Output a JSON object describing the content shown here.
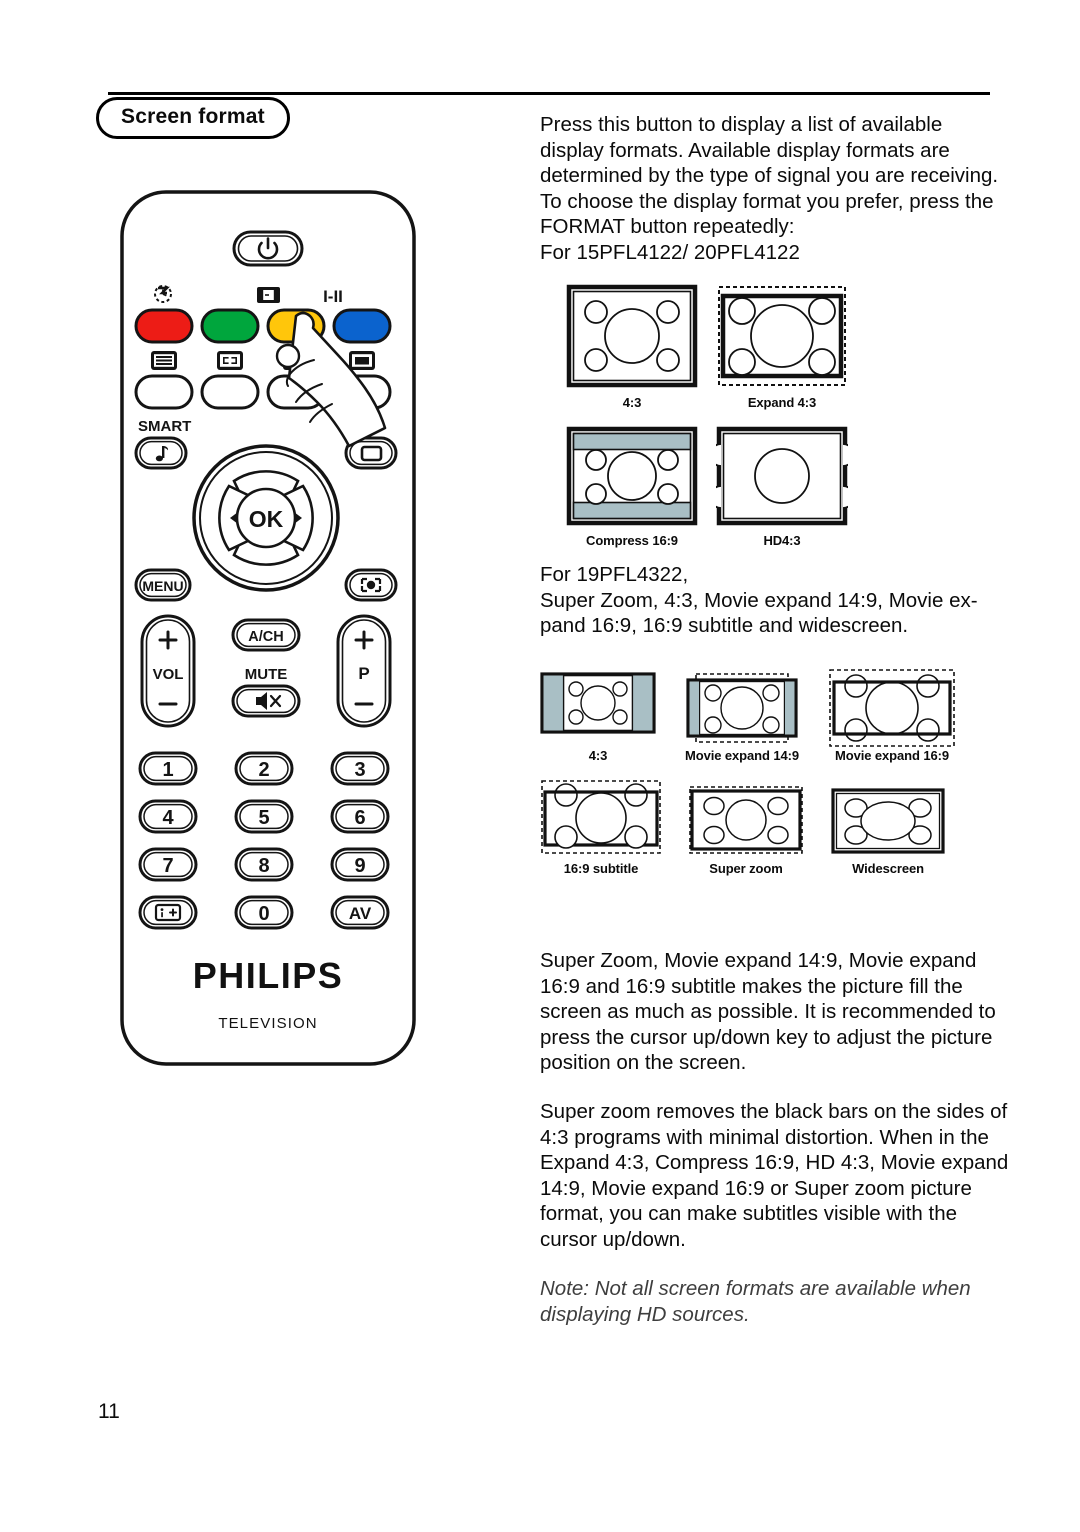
{
  "section": {
    "title": "Screen format"
  },
  "page": {
    "number": "11"
  },
  "body": {
    "p1": "Press this button to display a list of available display formats. Available display formats are determined by the type of signal you are receiving. To choose the display format you prefer, press the FORMAT button repeatedly:",
    "p1_model_line": "For 15PFL4122/ 20PFL4122",
    "p2_model_line": "For 19PFL4322,",
    "p2": "Super Zoom, 4:3, Movie expand 14:9, Movie ex-pand 16:9, 16:9 subtitle and widescreen.",
    "p3": "Super Zoom, Movie expand 14:9, Movie expand 16:9 and 16:9 subtitle makes the picture fill the screen as much as possible. It is recommended to press the cursor up/down key to adjust the picture position on the screen.",
    "p4": "Super zoom removes the black bars on the sides of 4:3 programs with minimal distortion. When in the Expand 4:3, Compress 16:9, HD 4:3, Movie expand 14:9, Movie expand 16:9 or Super zoom picture format, you can make subtitles visible with the cursor up/down.",
    "note": "Note: Not all screen formats are available when displaying HD sources."
  },
  "format_group_1": {
    "row1": [
      {
        "caption": "4:3",
        "icon": "format-4-3-diagram"
      },
      {
        "caption": "Expand 4:3",
        "icon": "format-expand-4-3-diagram"
      }
    ],
    "row2": [
      {
        "caption": "Compress 16:9",
        "icon": "format-compress-16-9-diagram"
      },
      {
        "caption": "HD4:3",
        "icon": "format-hd-4-3-diagram"
      }
    ]
  },
  "format_group_2": {
    "row1": [
      {
        "caption": "4:3",
        "icon": "format-4-3-wide-diagram"
      },
      {
        "caption": "Movie expand 14:9",
        "icon": "format-movie-expand-14-9-diagram"
      },
      {
        "caption": "Movie expand 16:9",
        "icon": "format-movie-expand-16-9-diagram"
      }
    ],
    "row2": [
      {
        "caption": "16:9 subtitle",
        "icon": "format-16-9-subtitle-diagram"
      },
      {
        "caption": "Super zoom",
        "icon": "format-super-zoom-diagram"
      },
      {
        "caption": "Widescreen",
        "icon": "format-widescreen-diagram"
      }
    ]
  },
  "remote": {
    "brand": "PHILIPS",
    "sub_brand": "TELEVISION",
    "power_button": "power-icon",
    "color_buttons": [
      {
        "name": "red",
        "color": "#ED1C16",
        "top_icon": "sleep-timer-icon",
        "below_icon": "teletext-icon"
      },
      {
        "name": "green",
        "color": "#00A63D",
        "top_icon": "",
        "below_icon": "subpage-icon"
      },
      {
        "name": "yellow",
        "color": "#FFC60B",
        "top_icon": "format-icon",
        "below_icon": "list-icon"
      },
      {
        "name": "blue",
        "color": "#0B63CE",
        "top_icon": "I-II",
        "below_icon": "screen-icon"
      }
    ],
    "smart_label": "SMART",
    "smart_icon": "music-note-icon",
    "smart_picture_icon": "screen-icon",
    "ok_label": "OK",
    "menu_label": "MENU",
    "surf_icon": "pixel-plus-icon",
    "vol_label": "VOL",
    "vol_plus": "+",
    "vol_minus": "−",
    "ach_label": "A/CH",
    "mute_label": "MUTE",
    "mute_icon": "mute-icon",
    "p_label": "P",
    "p_plus": "+",
    "p_minus": "−",
    "keypad": [
      "1",
      "2",
      "3",
      "4",
      "5",
      "6",
      "7",
      "8",
      "9",
      "0"
    ],
    "info_icon": "info-screen-icon",
    "av_label": "AV",
    "hand_pointer": "hand-pointing-icon"
  },
  "colors": {
    "gray_bar": "#a9bfc5",
    "outline": "#111111"
  }
}
